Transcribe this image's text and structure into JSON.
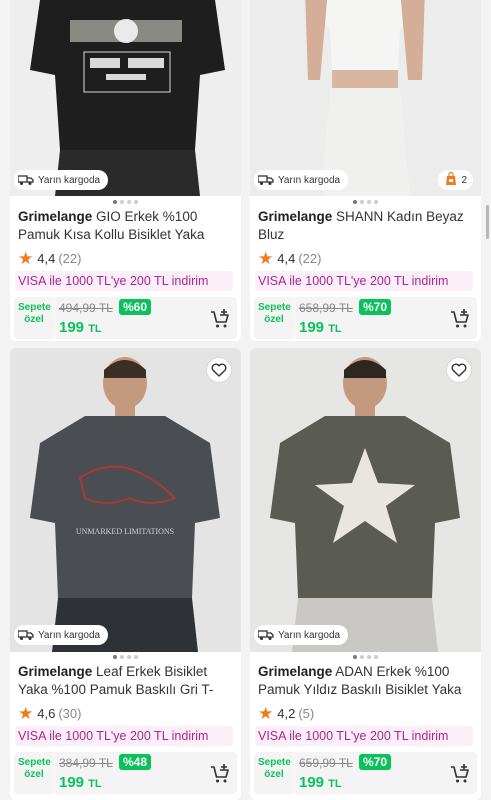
{
  "products": [
    {
      "brand": "Grimelange",
      "name": "GIO Erkek %100 Pamuk Kısa Kollu Bisiklet Yaka",
      "rating": "4,4",
      "reviews": "(22)",
      "promo": "VISA ile 1000 TL'ye 200 TL indirim",
      "sepete": "Sepete özel",
      "old_price": "494,99 TL",
      "discount": "%60",
      "new_price": "199",
      "currency": "TL",
      "cargo": "Yarın kargoda",
      "shirt_color": "#1e1e1e",
      "photo_slide": 1
    },
    {
      "brand": "Grimelange",
      "name": "SHANN Kadın Beyaz Bluz",
      "rating": "4,4",
      "reviews": "(22)",
      "promo": "VISA ile 1000 TL'ye 200 TL indirim",
      "sepete": "Sepete özel",
      "old_price": "658,99 TL",
      "discount": "%70",
      "new_price": "199",
      "currency": "TL",
      "cargo": "Yarın kargoda",
      "bubble_count": "2",
      "shirt_color": "#f5f5f3",
      "photo_slide": 1
    },
    {
      "brand": "Grimelange",
      "name": "Leaf Erkek Bisiklet Yaka %100 Pamuk Baskılı Gri T-",
      "rating": "4,6",
      "reviews": "(30)",
      "promo": "VISA ile 1000 TL'ye 200 TL indirim",
      "sepete": "Sepete özel",
      "old_price": "384,99 TL",
      "discount": "%48",
      "new_price": "199",
      "currency": "TL",
      "cargo": "Yarın kargoda",
      "print_text": "UNMARKED LIMITATIONS",
      "shirt_color": "#4a4d52",
      "photo_slide": 1
    },
    {
      "brand": "Grimelange",
      "name": "ADAN Erkek %100 Pamuk Yıldız Baskılı Bisiklet Yaka",
      "rating": "4,2",
      "reviews": "(5)",
      "promo": "VISA ile 1000 TL'ye 200 TL indirim",
      "sepete": "Sepete özel",
      "old_price": "659,99 TL",
      "discount": "%70",
      "new_price": "199",
      "currency": "TL",
      "cargo": "Yarın kargoda",
      "shirt_color": "#5a5b52",
      "photo_slide": 1
    }
  ],
  "icons": {
    "favorite": "heart-outline-icon",
    "cart": "add-to-cart-icon",
    "cargo": "truck-icon",
    "star": "star-icon",
    "bubble": "sale-bag-icon"
  },
  "colors": {
    "accent_green": "#0bc15c",
    "star_orange": "#f27a1a",
    "promo_pink": "#b0229a"
  }
}
